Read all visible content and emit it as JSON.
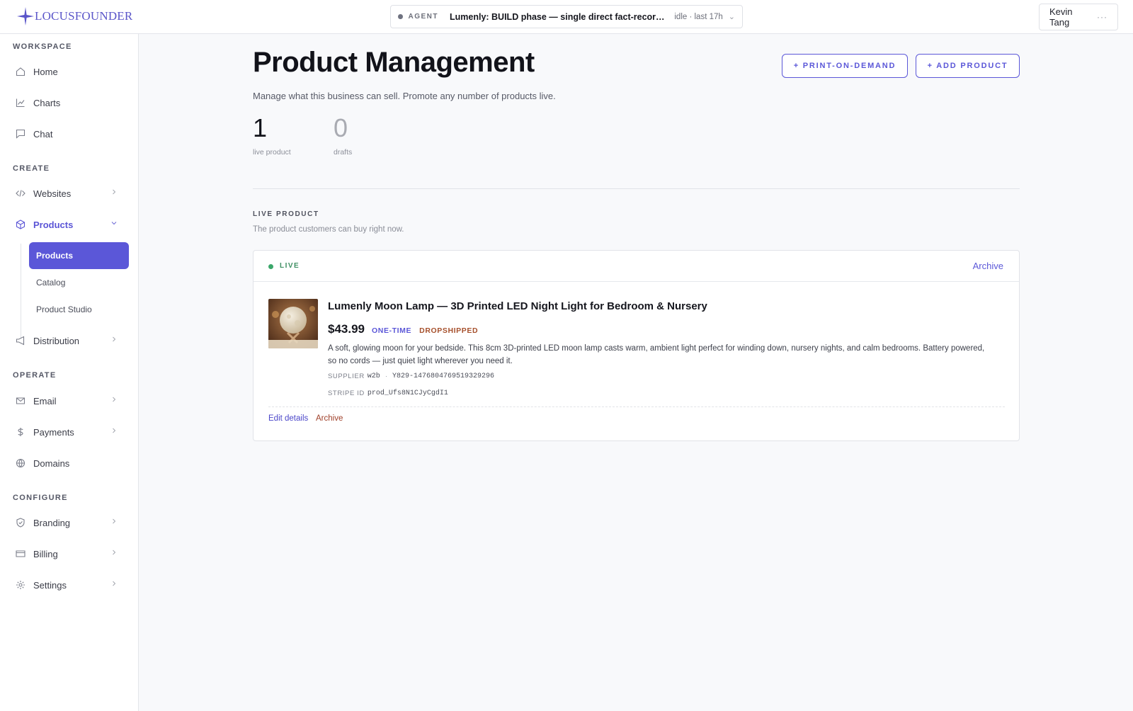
{
  "brand": {
    "name": "LOCUSFOUNDER"
  },
  "agent": {
    "tag": "AGENT",
    "title": "Lumenly: BUILD phase — single direct fact-recording ...",
    "status": "idle · last 17h"
  },
  "user": {
    "name": "Kevin Tang",
    "more": "···"
  },
  "sidebar": {
    "sections": {
      "workspace": "WORKSPACE",
      "create": "CREATE",
      "operate": "OPERATE",
      "configure": "CONFIGURE"
    },
    "items": {
      "home": "Home",
      "charts": "Charts",
      "chat": "Chat",
      "websites": "Websites",
      "products": "Products",
      "distribution": "Distribution",
      "email": "Email",
      "payments": "Payments",
      "domains": "Domains",
      "branding": "Branding",
      "billing": "Billing",
      "settings": "Settings"
    },
    "sub_items": {
      "products": "Products",
      "catalog": "Catalog",
      "product_studio": "Product Studio"
    }
  },
  "main": {
    "title": "Product Management",
    "subtitle": "Manage what this business can sell. Promote any number of products live.",
    "buttons": {
      "print_on_demand": "+ PRINT-ON-DEMAND",
      "add_product": "+ ADD PRODUCT"
    },
    "stats": {
      "live_count": "1",
      "live_label": "live product",
      "drafts_count": "0",
      "drafts_label": "drafts"
    },
    "section": {
      "heading": "LIVE PRODUCT",
      "description": "The product customers can buy right now."
    },
    "card": {
      "status": "LIVE",
      "archive": "Archive",
      "product": {
        "name": "Lumenly Moon Lamp — 3D Printed LED Night Light for Bedroom & Nursery",
        "price": "$43.99",
        "billing_tag": "ONE-TIME",
        "fulfillment_tag": "DROPSHIPPED",
        "description": "A soft, glowing moon for your bedside. This 8cm 3D-printed LED moon lamp casts warm, ambient light perfect for winding down, nursery nights, and calm bedrooms. Battery powered, so no cords — just quiet light wherever you need it.",
        "supplier_label": "SUPPLIER",
        "supplier_name": "w2b",
        "supplier_sep": "·",
        "supplier_id": "Y829-1476804769519329296",
        "stripe_label": "STRIPE ID",
        "stripe_id": "prod_Ufs8N1CJyCgdI1"
      },
      "actions": {
        "edit": "Edit details",
        "archive": "Archive"
      }
    }
  },
  "colors": {
    "accent": "#5b57d8",
    "live_green": "#3ba76a",
    "dropship_brown": "#a6502c"
  }
}
